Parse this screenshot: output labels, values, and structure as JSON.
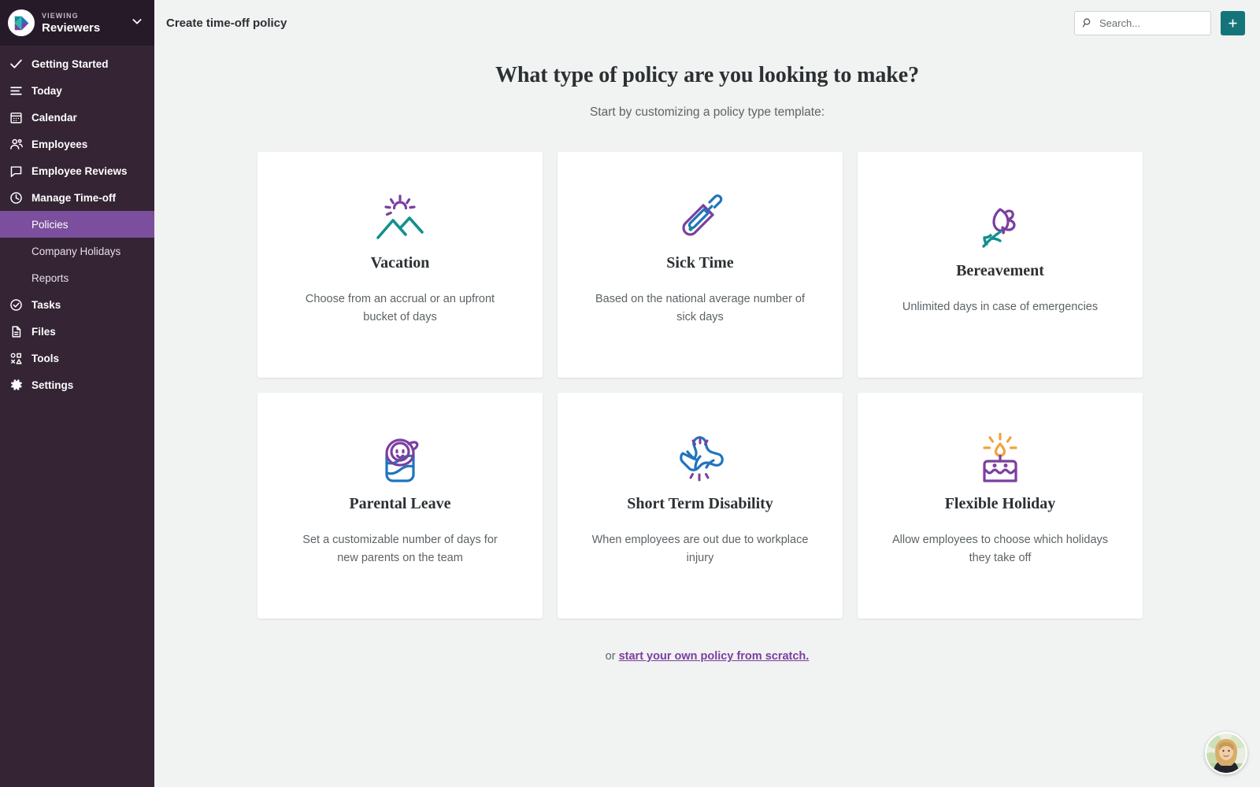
{
  "sidebar": {
    "org": {
      "viewing_label": "VIEWING",
      "name": "Reviewers",
      "chevron": "chevron-down"
    },
    "items": [
      {
        "label": "Getting Started",
        "icon": "check-icon"
      },
      {
        "label": "Today",
        "icon": "list-icon"
      },
      {
        "label": "Calendar",
        "icon": "calendar-icon"
      },
      {
        "label": "Employees",
        "icon": "people-icon"
      },
      {
        "label": "Employee Reviews",
        "icon": "chat-icon"
      },
      {
        "label": "Manage Time-off",
        "icon": "clock-icon"
      }
    ],
    "subitems": [
      {
        "label": "Policies",
        "active": true
      },
      {
        "label": "Company Holidays",
        "active": false
      },
      {
        "label": "Reports",
        "active": false
      }
    ],
    "items_after": [
      {
        "label": "Tasks",
        "icon": "check-circle-icon"
      },
      {
        "label": "Files",
        "icon": "file-icon"
      },
      {
        "label": "Tools",
        "icon": "shapes-icon"
      },
      {
        "label": "Settings",
        "icon": "gear-icon"
      }
    ]
  },
  "topbar": {
    "title": "Create time-off policy",
    "search_placeholder": "Search...",
    "add_label": "+"
  },
  "main": {
    "headline": "What type of policy are you looking to make?",
    "subhead": "Start by customizing a policy type template:",
    "footer_prefix": "or ",
    "footer_link": "start your own policy from scratch."
  },
  "cards": [
    {
      "title": "Vacation",
      "desc": "Choose from an accrual or an upfront bucket of days",
      "icon": "sun-mountains-icon"
    },
    {
      "title": "Sick Time",
      "desc": "Based on the national average number of sick days",
      "icon": "thermometer-icon"
    },
    {
      "title": "Bereavement",
      "desc": "Unlimited days in case of emergencies",
      "icon": "rose-icon"
    },
    {
      "title": "Parental Leave",
      "desc": "Set a customizable number of days for new parents on the team",
      "icon": "baby-icon"
    },
    {
      "title": "Short Term Disability",
      "desc": "When employees are out due to workplace injury",
      "icon": "bandaged-arm-icon"
    },
    {
      "title": "Flexible Holiday",
      "desc": "Allow employees to choose which holidays they take off",
      "icon": "birthday-cake-icon"
    }
  ],
  "colors": {
    "sidebar_bg": "#342434",
    "sidebar_header_bg": "#271a28",
    "active_purple": "#7b4f9d",
    "teal_accent": "#13757a",
    "icon_purple": "#7b3fa0",
    "icon_teal": "#13908f",
    "icon_blue": "#1f74bd",
    "icon_orange": "#f2a33c",
    "link_purple": "#7b3fa0",
    "page_bg": "#f1f2f2"
  }
}
